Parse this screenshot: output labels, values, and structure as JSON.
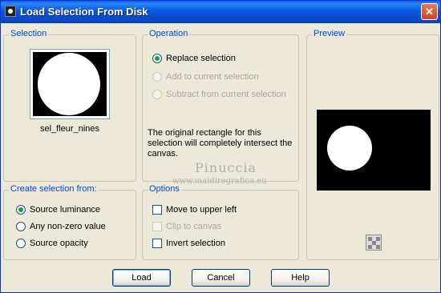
{
  "window": {
    "title": "Load Selection From Disk",
    "close_glyph": "✕"
  },
  "selection": {
    "title": "Selection",
    "file_name": "sel_fleur_nines"
  },
  "operation": {
    "title": "Operation",
    "options": [
      {
        "label": "Replace selection",
        "checked": true,
        "disabled": false
      },
      {
        "label": "Add to current selection",
        "checked": false,
        "disabled": true
      },
      {
        "label": "Subtract from current selection",
        "checked": false,
        "disabled": true
      }
    ],
    "info": "The original rectangle for this selection will completely intersect the canvas."
  },
  "preview": {
    "title": "Preview"
  },
  "create_from": {
    "title": "Create selection from:",
    "options": [
      {
        "label": "Source luminance",
        "checked": true
      },
      {
        "label": "Any non-zero value",
        "checked": false
      },
      {
        "label": "Source opacity",
        "checked": false
      }
    ]
  },
  "options": {
    "title": "Options",
    "items": [
      {
        "label": "Move to upper left",
        "checked": false,
        "disabled": false
      },
      {
        "label": "Clip to canvas",
        "checked": false,
        "disabled": true
      },
      {
        "label": "Invert selection",
        "checked": false,
        "disabled": false
      }
    ]
  },
  "buttons": {
    "load": "Load",
    "cancel": "Cancel",
    "help": "Help"
  },
  "watermark": {
    "line1": "Pinuccia",
    "line2": "www.maidiregrafica.eu"
  },
  "colors": {
    "title_bar": "#0a58dd",
    "group_title": "#0046d5",
    "dialog_bg": "#ece9d8",
    "close_button": "#d3411e"
  }
}
